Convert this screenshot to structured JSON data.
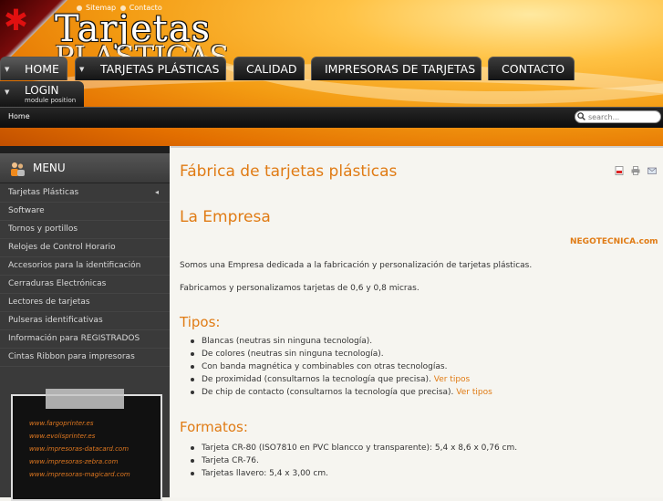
{
  "header": {
    "logo_text": "Tarjetas",
    "logo_text_2": "PLASTICAS",
    "top_links": [
      "Sitemap",
      "Contacto"
    ]
  },
  "nav": {
    "items": [
      "HOME",
      "TARJETAS PLÁSTICAS",
      "CALIDAD",
      "IMPRESORAS DE TARJETAS",
      "CONTACTO"
    ],
    "login": {
      "label": "LOGIN",
      "sub": "module position"
    }
  },
  "breadcrumb": "Home",
  "search": {
    "placeholder": "search..."
  },
  "sidebar": {
    "title": "MENU",
    "items": [
      "Tarjetas Plásticas",
      "Software",
      "Tornos y portillos",
      "Relojes de Control Horario",
      "Accesorios para la identificación",
      "Cerraduras Electrónicas",
      "Lectores de tarjetas",
      "Pulseras identificativas",
      "Información para REGISTRADOS",
      "Cintas Ribbon para impresoras"
    ],
    "banner_links": [
      "www.fargoprinter.es",
      "www.evolisprinter.es",
      "www.impresoras-datacard.com",
      "www.impresoras-zebra.com",
      "www.impresoras-magicard.com"
    ]
  },
  "content": {
    "page_title": "Fábrica de tarjetas plásticas",
    "section_title": "La Empresa",
    "brand": "NEGOTECNICA.com",
    "para1": "Somos una Empresa dedicada a la fabricación y personalización de tarjetas plásticas.",
    "para2": "Fabricamos y personalizamos tarjetas de 0,6 y 0,8 micras.",
    "tipos_title": "Tipos:",
    "tipos": [
      {
        "text": "Blancas (neutras sin ninguna tecnología).",
        "link": ""
      },
      {
        "text": "De colores (neutras sin ninguna tecnología).",
        "link": ""
      },
      {
        "text": "Con banda magnética y combinables con otras tecnologías.",
        "link": ""
      },
      {
        "text": "De proximidad (consultarnos la tecnología que precisa).",
        "link": "Ver tipos"
      },
      {
        "text": "De chip de contacto (consultarnos la tecnología que precisa).",
        "link": "Ver tipos"
      }
    ],
    "formatos_title": "Formatos:",
    "formatos": [
      "Tarjeta CR-80 (ISO7810 en PVC blancco y transparente): 5,4 x 8,6 x 0,76 cm.",
      "Tarjeta CR-76.",
      "Tarjetas llavero: 5,4 x 3,00 cm."
    ]
  },
  "colors": {
    "accent": "#e07b14",
    "sidebar_bg": "#3a3a3a",
    "content_bg": "#f6f5f0"
  }
}
